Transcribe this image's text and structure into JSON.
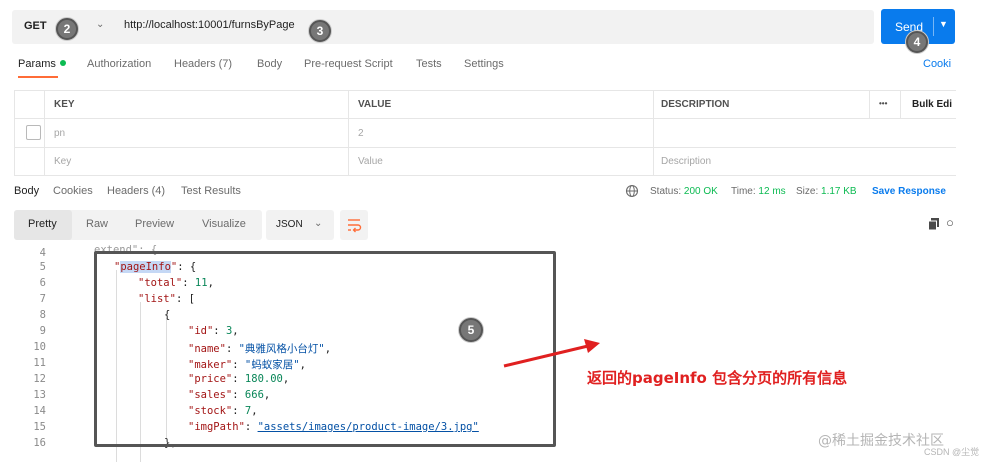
{
  "request": {
    "method": "GET",
    "url": "http://localhost:10001/furnsByPage",
    "send_label": "Send"
  },
  "steps": {
    "two": "2",
    "three": "3",
    "four": "4",
    "five": "5"
  },
  "request_tabs": {
    "params": "Params",
    "authorization": "Authorization",
    "headers": "Headers (7)",
    "body": "Body",
    "pre_request": "Pre-request Script",
    "tests": "Tests",
    "settings": "Settings",
    "cookies": "Cooki"
  },
  "params_table": {
    "headers": {
      "key": "KEY",
      "value": "VALUE",
      "description": "DESCRIPTION",
      "more": "•••",
      "bulk_edit": "Bulk Edi"
    },
    "row": {
      "key": "pn",
      "value": "2"
    },
    "placeholder": {
      "key": "Key",
      "value": "Value",
      "description": "Description"
    }
  },
  "response_tabs": {
    "body": "Body",
    "cookies": "Cookies",
    "headers": "Headers (4)",
    "test_results": "Test Results"
  },
  "response_status": {
    "status_label": "Status:",
    "status_value": "200 OK",
    "time_label": "Time:",
    "time_value": "12 ms",
    "size_label": "Size:",
    "size_value": "1.17 KB",
    "save_response": "Save Response"
  },
  "view_toolbar": {
    "pretty": "Pretty",
    "raw": "Raw",
    "preview": "Preview",
    "visualize": "Visualize",
    "format": "JSON"
  },
  "code": {
    "line_numbers": [
      "4",
      "5",
      "6",
      "7",
      "8",
      "9",
      "10",
      "11",
      "12",
      "13",
      "14",
      "15",
      "16"
    ],
    "line4": "extend\": {",
    "pageinfo_key": "pageInfo",
    "total_key": "\"total\"",
    "total_val": "11",
    "list_key": "\"list\"",
    "id_key": "\"id\"",
    "id_val": "3",
    "name_key": "\"name\"",
    "name_val": "\"典雅风格小台灯\"",
    "maker_key": "\"maker\"",
    "maker_val": "\"蚂蚁家居\"",
    "price_key": "\"price\"",
    "price_val": "180.00",
    "sales_key": "\"sales\"",
    "sales_val": "666",
    "stock_key": "\"stock\"",
    "stock_val": "7",
    "img_key": "\"imgPath\"",
    "img_val": "\"assets/images/product-image/3.jpg\""
  },
  "annotation": "返回的pageInfo 包含分页的所有信息",
  "watermark": {
    "main": "@稀土掘金技术社区",
    "sub": "CSDN @尘觉"
  },
  "colors": {
    "accent_blue": "#097bed",
    "active_orange": "#ff6c37",
    "status_green": "#0cbb52",
    "annotation_red": "#e02020"
  }
}
